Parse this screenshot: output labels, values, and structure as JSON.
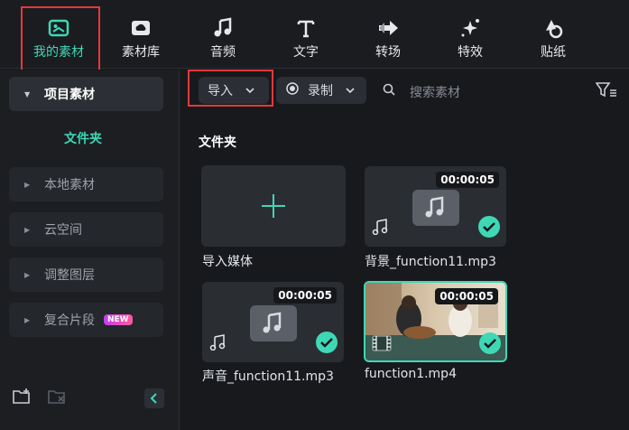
{
  "toolbar": {
    "tabs": [
      {
        "label": "我的素材",
        "icon": "my-media-icon"
      },
      {
        "label": "素材库",
        "icon": "stock-media-icon"
      },
      {
        "label": "音频",
        "icon": "music-note-icon"
      },
      {
        "label": "文字",
        "icon": "text-t-icon"
      },
      {
        "label": "转场",
        "icon": "transition-icon"
      },
      {
        "label": "特效",
        "icon": "sparkle-effects-icon"
      },
      {
        "label": "贴纸",
        "icon": "sticker-icon"
      }
    ],
    "active_tab": "我的素材"
  },
  "sidebar": {
    "project_media": "项目素材",
    "folder": "文件夹",
    "items": [
      {
        "label": "本地素材"
      },
      {
        "label": "云空间"
      },
      {
        "label": "调整图层"
      },
      {
        "label": "复合片段",
        "badge": "NEW"
      }
    ]
  },
  "mainbar": {
    "import_label": "导入",
    "record_label": "录制",
    "search_placeholder": "搜索素材"
  },
  "content": {
    "section_title": "文件夹",
    "import_card_label": "导入媒体",
    "items": [
      {
        "name": "背景_function11.mp3",
        "duration": "00:00:05",
        "type": "audio"
      },
      {
        "name": "声音_function11.mp3",
        "duration": "00:00:05",
        "type": "audio"
      },
      {
        "name": "function1.mp4",
        "duration": "00:00:05",
        "type": "video"
      }
    ]
  },
  "colors": {
    "accent": "#3fd8b6",
    "highlight": "#e5383b",
    "background": "#17191d",
    "card": "#2a2d32"
  }
}
